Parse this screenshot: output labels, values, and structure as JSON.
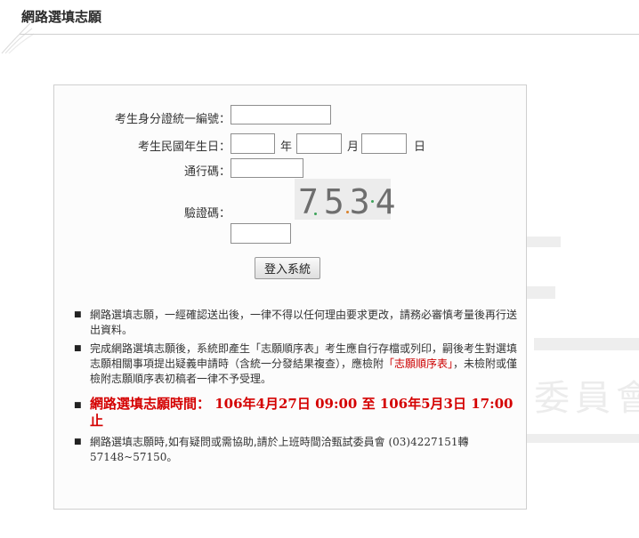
{
  "page": {
    "title": "網路選填志願"
  },
  "background": {
    "watermark": "委員會"
  },
  "form": {
    "id_label": "考生身分證統一編號：",
    "birth_label": "考生民國年生日：",
    "year_unit": "年",
    "month_unit": "月",
    "day_unit": "日",
    "passcode_label": "通行碼：",
    "captcha_label": "驗證碼：",
    "captcha_text": "7534",
    "login_button": "登入系統"
  },
  "notes": {
    "n1": "網路選填志願，一經確認送出後，一律不得以任何理由要求更改，請務必審慎考量後再行送出資料。",
    "n2_pre": "完成網路選填志願後，系統即產生「志願順序表」考生應自行存檔或列印，嗣後考生對選填志願相關事項提出疑義申請時（含統一分發結果複查），應檢附",
    "n2_red": "「志願順序表」",
    "n2_post": "，未檢附或僅檢附志願順序表初稿者一律不予受理。",
    "n3": "網路選填志願時間： 106年4月27日 09:00 至 106年5月3日 17:00 止",
    "n4_pre": "網路選填志願時,如有疑問或需協助,請於上班時間洽甄試委員會",
    "n4_num": " (03)4227151轉57148~57150。"
  }
}
